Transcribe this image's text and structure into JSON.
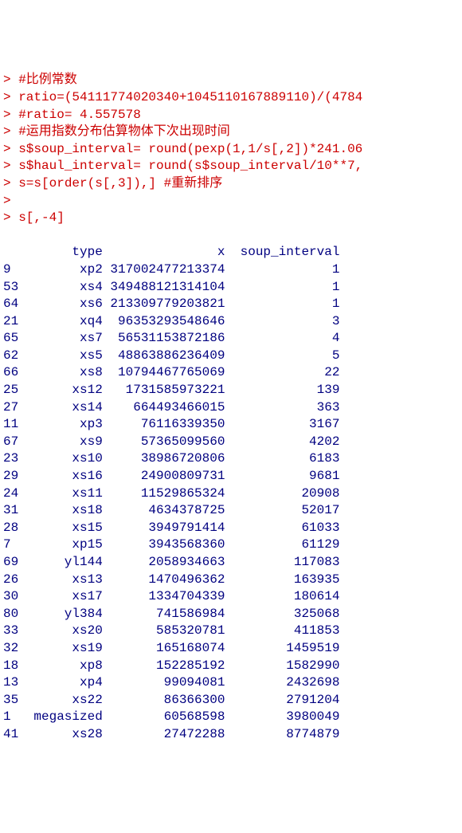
{
  "console": {
    "lines": [
      "> #比例常数",
      "> ratio=(54111774020340+1045110167889110)/(4784",
      "> #ratio= 4.557578",
      "> #运用指数分布估算物体下次出现时间",
      "> s$soup_interval= round(pexp(1,1/s[,2])*241.06",
      "> s$haul_interval= round(s$soup_interval/10**7,",
      "> s=s[order(s[,3]),] #重新排序",
      ">",
      "> s[,-4]"
    ]
  },
  "table": {
    "headers": {
      "idx": "",
      "type": "type",
      "x": "x",
      "soup": "soup_interval"
    },
    "rows": [
      {
        "idx": "9",
        "type": "xp2",
        "x": "317002477213374",
        "soup": "1"
      },
      {
        "idx": "53",
        "type": "xs4",
        "x": "349488121314104",
        "soup": "1"
      },
      {
        "idx": "64",
        "type": "xs6",
        "x": "213309779203821",
        "soup": "1"
      },
      {
        "idx": "21",
        "type": "xq4",
        "x": "96353293548646",
        "soup": "3"
      },
      {
        "idx": "65",
        "type": "xs7",
        "x": "56531153872186",
        "soup": "4"
      },
      {
        "idx": "62",
        "type": "xs5",
        "x": "48863886236409",
        "soup": "5"
      },
      {
        "idx": "66",
        "type": "xs8",
        "x": "10794467765069",
        "soup": "22"
      },
      {
        "idx": "25",
        "type": "xs12",
        "x": "1731585973221",
        "soup": "139"
      },
      {
        "idx": "27",
        "type": "xs14",
        "x": "664493466015",
        "soup": "363"
      },
      {
        "idx": "11",
        "type": "xp3",
        "x": "76116339350",
        "soup": "3167"
      },
      {
        "idx": "67",
        "type": "xs9",
        "x": "57365099560",
        "soup": "4202"
      },
      {
        "idx": "23",
        "type": "xs10",
        "x": "38986720806",
        "soup": "6183"
      },
      {
        "idx": "29",
        "type": "xs16",
        "x": "24900809731",
        "soup": "9681"
      },
      {
        "idx": "24",
        "type": "xs11",
        "x": "11529865324",
        "soup": "20908"
      },
      {
        "idx": "31",
        "type": "xs18",
        "x": "4634378725",
        "soup": "52017"
      },
      {
        "idx": "28",
        "type": "xs15",
        "x": "3949791414",
        "soup": "61033"
      },
      {
        "idx": "7",
        "type": "xp15",
        "x": "3943568360",
        "soup": "61129"
      },
      {
        "idx": "69",
        "type": "yl144",
        "x": "2058934663",
        "soup": "117083"
      },
      {
        "idx": "26",
        "type": "xs13",
        "x": "1470496362",
        "soup": "163935"
      },
      {
        "idx": "30",
        "type": "xs17",
        "x": "1334704339",
        "soup": "180614"
      },
      {
        "idx": "80",
        "type": "yl384",
        "x": "741586984",
        "soup": "325068"
      },
      {
        "idx": "33",
        "type": "xs20",
        "x": "585320781",
        "soup": "411853"
      },
      {
        "idx": "32",
        "type": "xs19",
        "x": "165168074",
        "soup": "1459519"
      },
      {
        "idx": "18",
        "type": "xp8",
        "x": "152285192",
        "soup": "1582990"
      },
      {
        "idx": "13",
        "type": "xp4",
        "x": "99094081",
        "soup": "2432698"
      },
      {
        "idx": "35",
        "type": "xs22",
        "x": "86366300",
        "soup": "2791204"
      },
      {
        "idx": "1",
        "type": "megasized",
        "x": "60568598",
        "soup": "3980049"
      },
      {
        "idx": "41",
        "type": "xs28",
        "x": "27472288",
        "soup": "8774879"
      }
    ]
  }
}
